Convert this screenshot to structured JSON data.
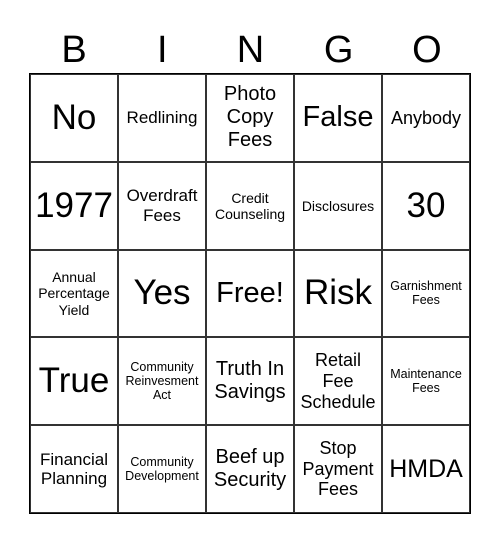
{
  "header": [
    "B",
    "I",
    "N",
    "G",
    "O"
  ],
  "cells": [
    "No",
    "Redlining",
    "Photo\nCopy\nFees",
    "False",
    "Anybody",
    "1977",
    "Overdraft\nFees",
    "Credit\nCounseling",
    "Disclosures",
    "30",
    "Annual\nPercentage\nYield",
    "Yes",
    "Free!",
    "Risk",
    "Garnishment\nFees",
    "True",
    "Community\nReinvesment\nAct",
    "Truth In\nSavings",
    "Retail\nFee\nSchedule",
    "Maintenance\nFees",
    "Financial\nPlanning",
    "Community\nDevelopment",
    "Beef up\nSecurity",
    "Stop\nPayment\nFees",
    "HMDA"
  ]
}
